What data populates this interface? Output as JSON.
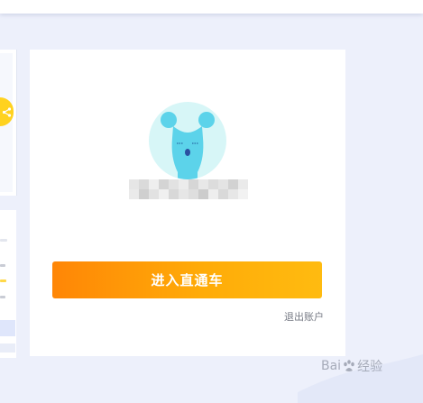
{
  "card": {
    "enter_button_label": "进入直通车",
    "logout_label": "退出账户"
  },
  "watermark": {
    "brand_left": "Bai",
    "brand_right": "经验"
  },
  "icons": {
    "avatar": "blue-bunny-avatar-icon",
    "share": "share-icon",
    "watermark": "baidu-paw-icon"
  },
  "colors": {
    "page_background": "#edf0fb",
    "button_gradient_start": "#ff8606",
    "button_gradient_end": "#ffbb10",
    "avatar_background": "#d7f6f7",
    "avatar_figure": "#5cd3ea",
    "share_badge": "#ffd21f"
  }
}
